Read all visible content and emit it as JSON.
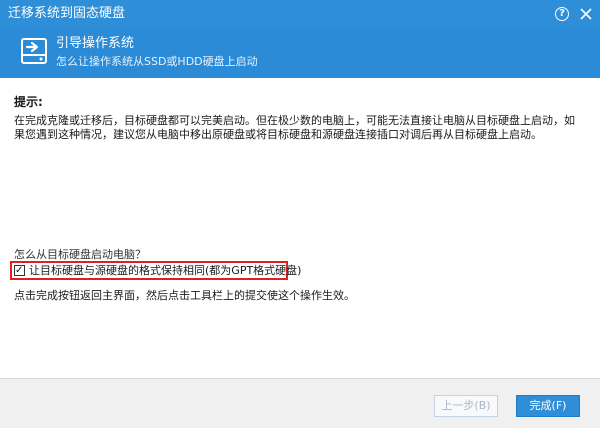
{
  "window": {
    "title": "迁移系统到固态硬盘"
  },
  "header": {
    "title": "引导操作系统",
    "subtitle": "怎么让操作系统从SSD或HDD硬盘上启动",
    "icon": "drive-arrow-icon"
  },
  "content": {
    "tip_heading": "提示:",
    "tip_body": "在完成克隆或迁移后，目标硬盘都可以完美启动。但在极少数的电脑上，可能无法直接让电脑从目标硬盘上启动，如果您遇到这种情况，建议您从电脑中移出原硬盘或将目标硬盘和源硬盘连接插口对调后再从目标硬盘上启动。",
    "question": "怎么从目标硬盘启动电脑？",
    "checkbox_label": "让目标硬盘与源硬盘的格式保持相同(都为GPT格式硬盘)",
    "checkbox_checked": true,
    "note": "点击完成按钮返回主界面，然后点击工具栏上的提交使这个操作生效。"
  },
  "footer": {
    "prev_label": "上一步(B)",
    "finish_label": "完成(F)"
  },
  "colors": {
    "titlebar": "#2f8ed8",
    "header": "#2b8bd6",
    "highlight_border": "#e02020"
  }
}
